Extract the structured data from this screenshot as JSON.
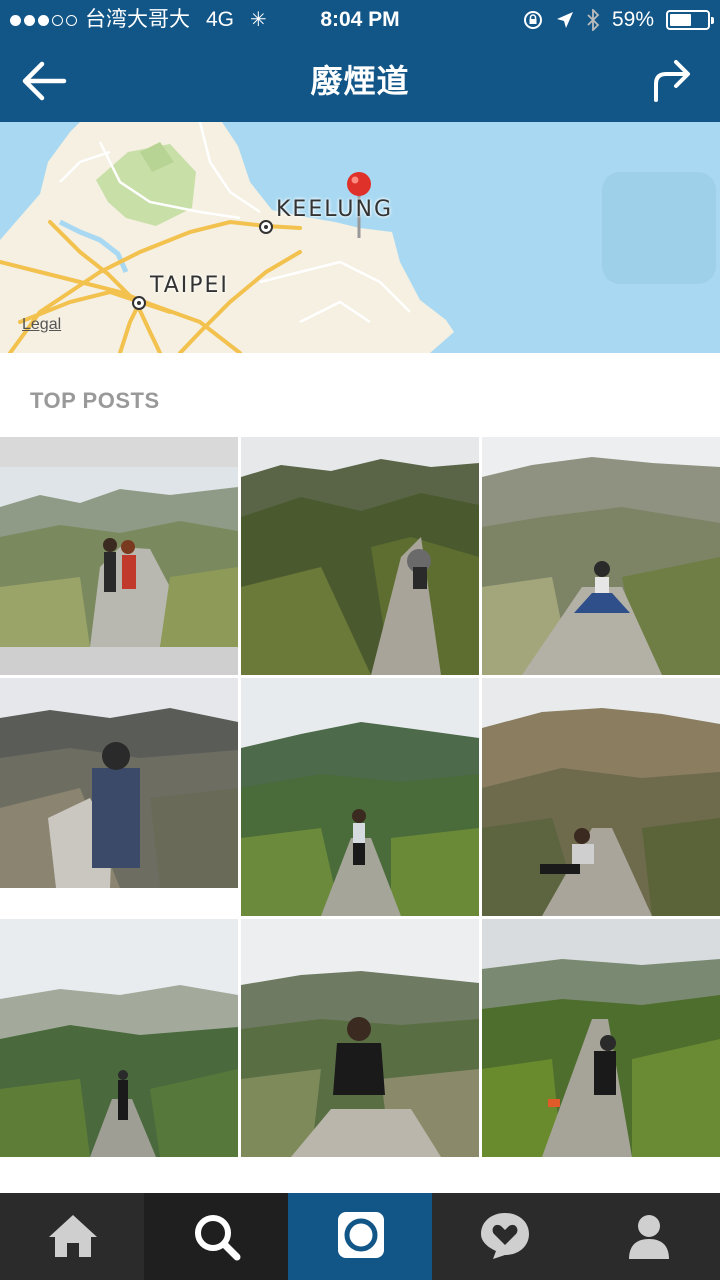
{
  "status_bar": {
    "carrier": "台湾大哥大",
    "network": "4G",
    "time": "8:04 PM",
    "battery": "59%",
    "battery_level": 0.59,
    "signal_bars": 3,
    "signal_total": 5
  },
  "nav": {
    "title": "廢煙道",
    "back_icon": "arrow-left-icon",
    "share_icon": "share-arrow-icon"
  },
  "map": {
    "labels": [
      "KEELUNG",
      "TAIPEI"
    ],
    "legal": "Legal",
    "pin_icon": "map-pin-icon"
  },
  "section": {
    "title": "TOP POSTS"
  },
  "posts": [
    {
      "scene": "couple on pipeline ridge"
    },
    {
      "scene": "person with umbrella on pipe, misty hills"
    },
    {
      "scene": "woman sitting on pipe"
    },
    {
      "scene": "man with backpack, follow-me shot"
    },
    {
      "scene": "woman standing on pipe, green valley"
    },
    {
      "scene": "woman sitting on pipe, brown hills"
    },
    {
      "scene": "man standing on path, foggy hills"
    },
    {
      "scene": "woman crouching on pipe"
    },
    {
      "scene": "woman sitting on pipe, fog"
    }
  ],
  "tabs": [
    {
      "name": "home",
      "icon": "home-icon"
    },
    {
      "name": "search",
      "icon": "search-icon"
    },
    {
      "name": "camera",
      "icon": "camera-icon"
    },
    {
      "name": "activity",
      "icon": "heart-bubble-icon"
    },
    {
      "name": "profile",
      "icon": "profile-icon"
    }
  ],
  "colors": {
    "brand": "#125688",
    "tabbar": "#2b2b2b",
    "section_title": "#999999"
  }
}
